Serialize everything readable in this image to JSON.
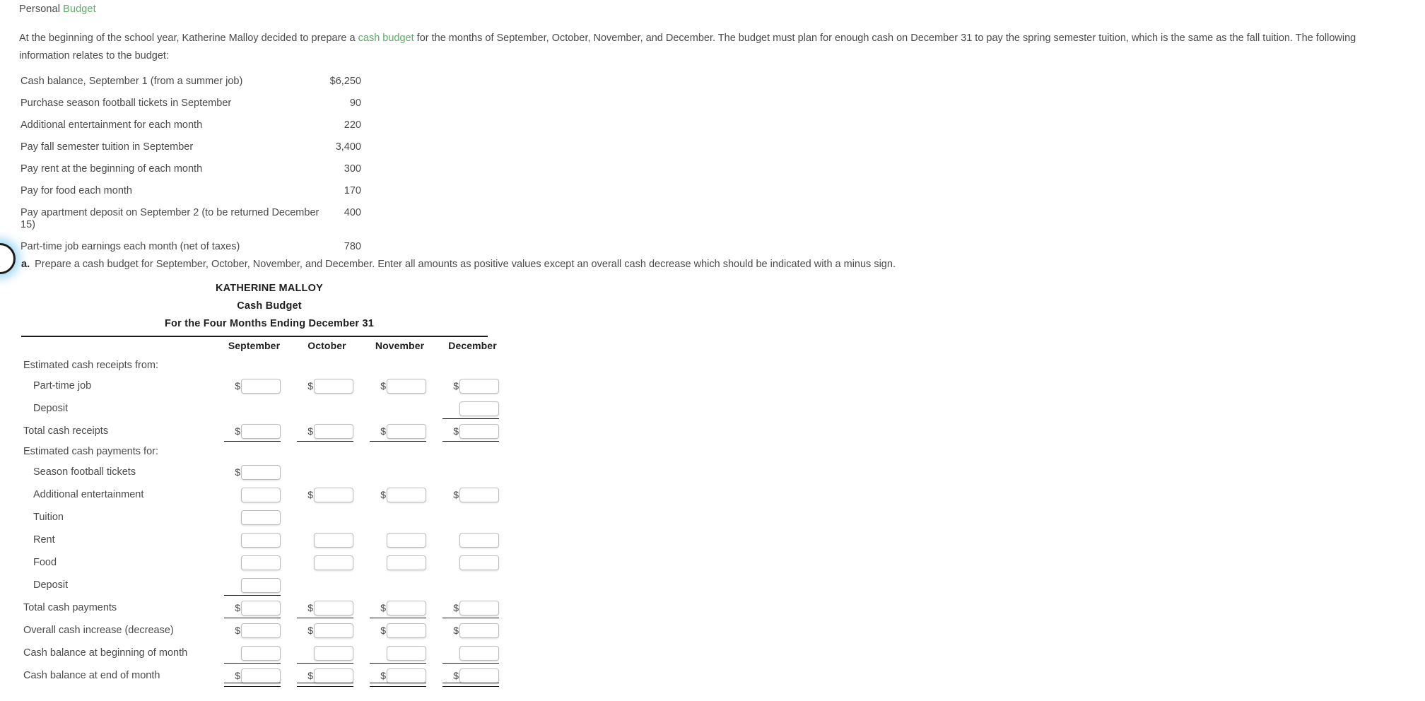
{
  "breadcrumb": {
    "prefix": "Personal",
    "accent": "Budget"
  },
  "intro": {
    "part1": "At the beginning of the school year, Katherine Malloy decided to prepare a ",
    "link": "cash budget",
    "part2": " for the months of September, October, November, and December. The budget must plan for enough cash on December 31 to pay the spring semester tuition, which is the same as the fall tuition. The following information relates to the budget:"
  },
  "given_data": {
    "rows": [
      {
        "label": "Cash balance, September 1 (from a summer job)",
        "amount": "$6,250"
      },
      {
        "label": "Purchase season football tickets in September",
        "amount": "90"
      },
      {
        "label": "Additional entertainment for each month",
        "amount": "220"
      },
      {
        "label": "Pay fall semester tuition in September",
        "amount": "3,400"
      },
      {
        "label": "Pay rent at the beginning of each month",
        "amount": "300"
      },
      {
        "label": "Pay for food each month",
        "amount": "170"
      },
      {
        "label": "Pay apartment deposit on September 2 (to be returned December 15)",
        "amount": "400"
      },
      {
        "label": "Part-time job earnings each month (net of taxes)",
        "amount": "780"
      }
    ]
  },
  "requirement": {
    "letter": "a.",
    "text": "Prepare a cash budget for September, October, November, and December. Enter all amounts as positive values except an overall cash decrease which should be indicated with a minus sign."
  },
  "form": {
    "title_line1": "KATHERINE MALLOY",
    "title_line2": "Cash Budget",
    "title_line3": "For the Four Months Ending December 31",
    "columns": [
      "September",
      "October",
      "November",
      "December"
    ],
    "dollar_symbol": "$",
    "rows": [
      {
        "label": "Estimated cash receipts from:",
        "type": "section"
      },
      {
        "label": "Part-time job",
        "type": "input",
        "indent": true,
        "cells": [
          {
            "field": true,
            "dollar": true
          },
          {
            "field": true,
            "dollar": true
          },
          {
            "field": true,
            "dollar": true
          },
          {
            "field": true,
            "dollar": true
          }
        ]
      },
      {
        "label": "Deposit",
        "type": "input",
        "indent": true,
        "cells": [
          {
            "field": false
          },
          {
            "field": false
          },
          {
            "field": false
          },
          {
            "field": true,
            "dollar": false,
            "rule": "single"
          }
        ]
      },
      {
        "label": "Total cash receipts",
        "type": "total",
        "cells": [
          {
            "field": true,
            "dollar": true,
            "rule": "single"
          },
          {
            "field": true,
            "dollar": true,
            "rule": "single"
          },
          {
            "field": true,
            "dollar": true,
            "rule": "single"
          },
          {
            "field": true,
            "dollar": true,
            "rule": "single"
          }
        ]
      },
      {
        "label": "Estimated cash payments for:",
        "type": "section"
      },
      {
        "label": "Season football tickets",
        "type": "input",
        "indent": true,
        "cells": [
          {
            "field": true,
            "dollar": true
          },
          {
            "field": false
          },
          {
            "field": false
          },
          {
            "field": false
          }
        ]
      },
      {
        "label": "Additional entertainment",
        "type": "input",
        "indent": true,
        "cells": [
          {
            "field": true,
            "dollar": false
          },
          {
            "field": true,
            "dollar": true
          },
          {
            "field": true,
            "dollar": true
          },
          {
            "field": true,
            "dollar": true
          }
        ]
      },
      {
        "label": "Tuition",
        "type": "input",
        "indent": true,
        "cells": [
          {
            "field": true,
            "dollar": false
          },
          {
            "field": false
          },
          {
            "field": false
          },
          {
            "field": false
          }
        ]
      },
      {
        "label": "Rent",
        "type": "input",
        "indent": true,
        "cells": [
          {
            "field": true,
            "dollar": false
          },
          {
            "field": true,
            "dollar": false
          },
          {
            "field": true,
            "dollar": false
          },
          {
            "field": true,
            "dollar": false
          }
        ]
      },
      {
        "label": "Food",
        "type": "input",
        "indent": true,
        "cells": [
          {
            "field": true,
            "dollar": false
          },
          {
            "field": true,
            "dollar": false
          },
          {
            "field": true,
            "dollar": false
          },
          {
            "field": true,
            "dollar": false
          }
        ]
      },
      {
        "label": "Deposit",
        "type": "input",
        "indent": true,
        "cells": [
          {
            "field": true,
            "dollar": false,
            "rule": "single"
          },
          {
            "field": false
          },
          {
            "field": false
          },
          {
            "field": false
          }
        ]
      },
      {
        "label": "Total cash payments",
        "type": "total",
        "cells": [
          {
            "field": true,
            "dollar": true,
            "rule": "single"
          },
          {
            "field": true,
            "dollar": true,
            "rule": "single"
          },
          {
            "field": true,
            "dollar": true,
            "rule": "single"
          },
          {
            "field": true,
            "dollar": true,
            "rule": "single"
          }
        ]
      },
      {
        "label": "Overall cash increase (decrease)",
        "type": "total",
        "cells": [
          {
            "field": true,
            "dollar": true
          },
          {
            "field": true,
            "dollar": true
          },
          {
            "field": true,
            "dollar": true
          },
          {
            "field": true,
            "dollar": true
          }
        ]
      },
      {
        "label": "Cash balance at beginning of month",
        "type": "total",
        "cells": [
          {
            "field": true,
            "dollar": false,
            "rule": "single"
          },
          {
            "field": true,
            "dollar": false,
            "rule": "single"
          },
          {
            "field": true,
            "dollar": false,
            "rule": "single"
          },
          {
            "field": true,
            "dollar": false,
            "rule": "single"
          }
        ]
      },
      {
        "label": "Cash balance at end of month",
        "type": "total",
        "cells": [
          {
            "field": true,
            "dollar": true,
            "rule": "double"
          },
          {
            "field": true,
            "dollar": true,
            "rule": "double"
          },
          {
            "field": true,
            "dollar": true,
            "rule": "double"
          },
          {
            "field": true,
            "dollar": true,
            "rule": "double"
          }
        ]
      }
    ]
  },
  "colors": {
    "accent_green": "#5cab68",
    "text": "#4a4a4a",
    "rule": "#1b1b1b"
  }
}
